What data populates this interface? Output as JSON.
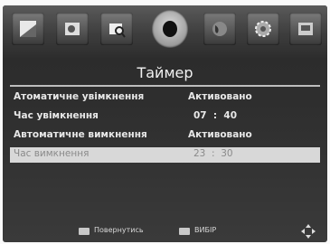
{
  "menu": {
    "icons": [
      {
        "name": "picture-icon"
      },
      {
        "name": "image-icon"
      },
      {
        "name": "search-channel-icon"
      },
      {
        "name": "timer-icon",
        "active": true
      },
      {
        "name": "globe-icon"
      },
      {
        "name": "settings-gear-icon"
      },
      {
        "name": "system-icon"
      }
    ],
    "title": "Таймер"
  },
  "rows": [
    {
      "label": "Атоматичне увімкнення",
      "value": "Активовано"
    },
    {
      "label": "Час увімкнення",
      "value": "07  :  40"
    },
    {
      "label": "Автоматичне вимкнення",
      "value": "Активовано"
    },
    {
      "label": "Час вимкнення",
      "value": "23  :  30",
      "selected": true
    }
  ],
  "footer": {
    "back_label": "Повернутись",
    "ok_label": "ВИБІР",
    "nav_icon": "directional-pad-icon"
  },
  "colors": {
    "selected_row": "#d8d8d8",
    "background": "#2e2e2e"
  }
}
